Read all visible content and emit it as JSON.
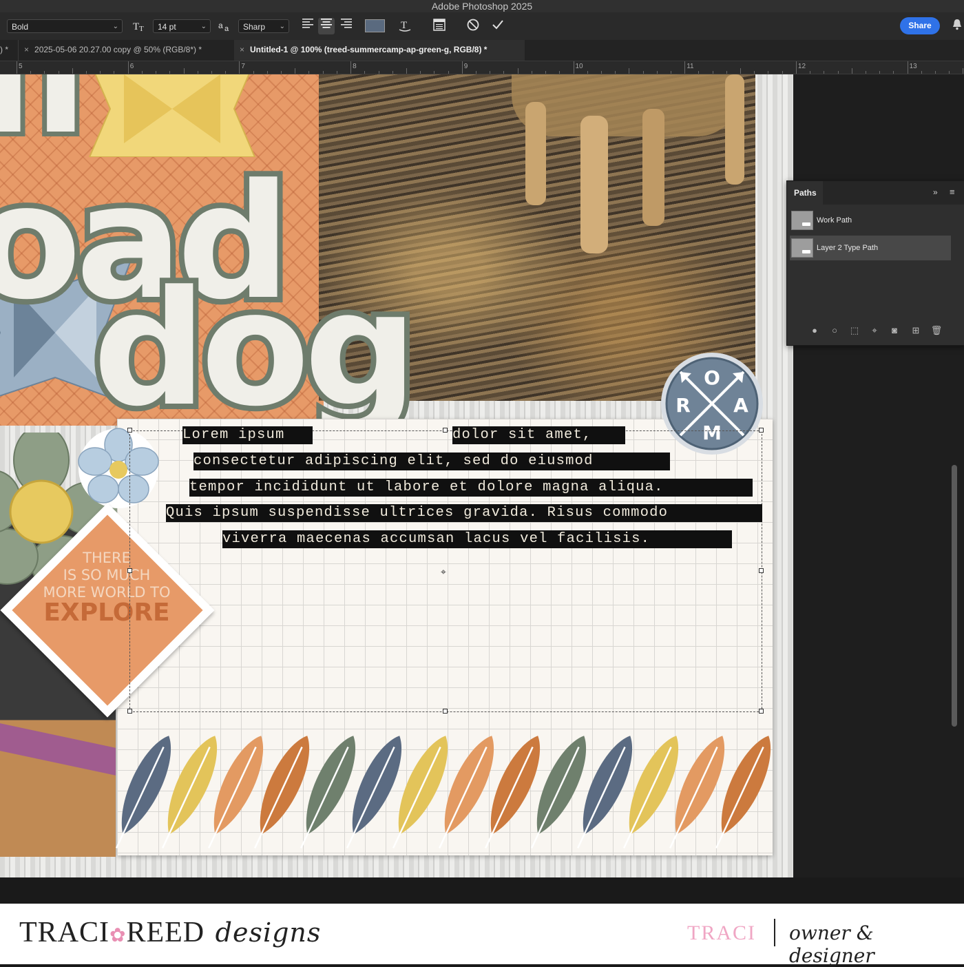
{
  "app": {
    "title": "Adobe Photoshop 2025"
  },
  "options_bar": {
    "font_style": "Bold",
    "font_size": "14 pt",
    "anti_alias": "Sharp",
    "anti_alias_icon_label": "a",
    "text_color": "#5a6a7f",
    "share_label": "Share"
  },
  "tabs": [
    {
      "label": ") *"
    },
    {
      "label": "2025-05-06 20.27.00 copy @ 50% (RGB/8*) *"
    },
    {
      "label": "Untitled-1 @ 100% (treed-summercamp-ap-green-g, RGB/8) *",
      "active": true
    }
  ],
  "ruler": {
    "numbers": [
      "5",
      "6",
      "7",
      "8",
      "9",
      "10",
      "11",
      "12",
      "13"
    ]
  },
  "paths_panel": {
    "tab_label": "Paths",
    "items": [
      {
        "label": "Work Path"
      },
      {
        "label": "Layer 2 Type Path",
        "selected": true
      }
    ]
  },
  "document": {
    "title_words": [
      "oad",
      "dog"
    ],
    "badge_letters": [
      "O",
      "R",
      "A",
      "M"
    ],
    "sticker_lines": [
      "THERE",
      "IS SO MUCH",
      "MORE WORLD TO",
      "EXPLORE"
    ],
    "journal_lines": [
      "Lorem ipsum",
      "dolor sit amet,",
      "consectetur adipiscing elit, sed do eiusmod",
      "tempor incididunt ut labore et dolore magna aliqua.",
      "Quis ipsum suspendisse ultrices gravida. Risus commodo",
      "viverra maecenas accumsan lacus vel facilisis."
    ],
    "feather_colors": [
      "#5b6b82",
      "#e3c45a",
      "#e39a62",
      "#cc7a3e",
      "#6f806d",
      "#5b6b82",
      "#e3c45a",
      "#e39a62",
      "#cc7a3e",
      "#6f806d",
      "#5b6b82",
      "#e3c45a",
      "#e39a62",
      "#cc7a3e"
    ]
  },
  "footer": {
    "brand_left": "TRACI",
    "brand_right": "REED",
    "brand_script": "designs",
    "name": "TRACI",
    "role": "owner & designer"
  },
  "colors": {
    "accent_blue": "#2f72e8",
    "brand_pink": "#e98fb3",
    "sage": "#6e7c6c",
    "orange_paper": "#e79a68"
  }
}
